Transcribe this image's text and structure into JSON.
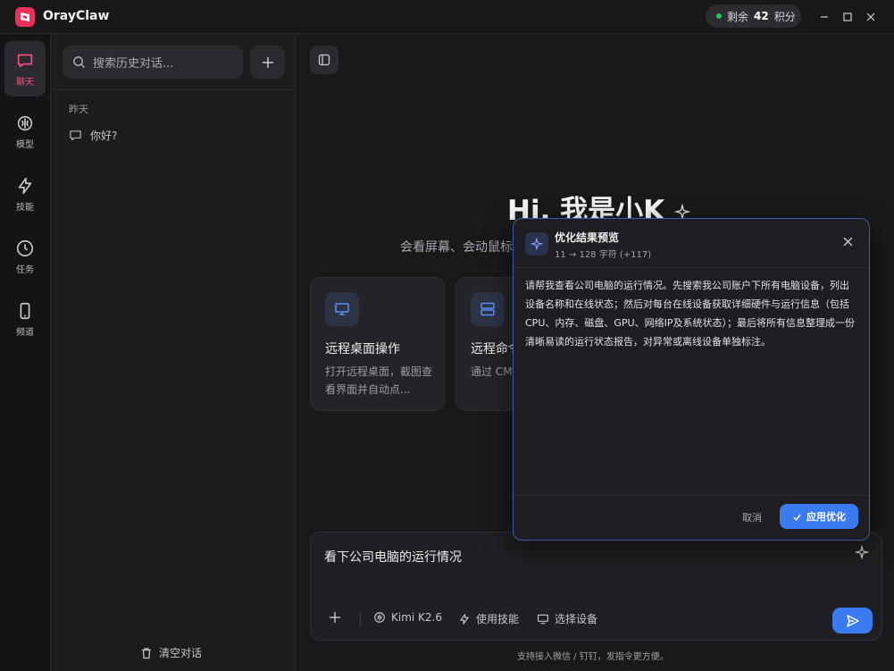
{
  "app": {
    "name": "OrayClaw"
  },
  "credits": {
    "prefix": "剩余",
    "amount": "42",
    "suffix": "积分"
  },
  "rail": {
    "items": [
      {
        "label": "聊天",
        "icon": "chat-icon",
        "active": true
      },
      {
        "label": "模型",
        "icon": "model-icon"
      },
      {
        "label": "技能",
        "icon": "lightning-icon"
      },
      {
        "label": "任务",
        "icon": "clock-icon"
      },
      {
        "label": "频道",
        "icon": "phone-icon"
      }
    ]
  },
  "history": {
    "search_placeholder": "搜索历史对话...",
    "group_label": "昨天",
    "items": [
      {
        "title": "你好?"
      }
    ],
    "clear_label": "清空对话"
  },
  "main": {
    "hero_title": "Hi, 我是小K",
    "hero_subtitle": "会看屏幕、会动鼠标",
    "cards": [
      {
        "title": "远程桌面操作",
        "desc": "打开远程桌面，截图查看界面并自动点...",
        "icon": "monitor-icon"
      },
      {
        "title": "远程命令",
        "desc": "通过 CMD 程设备上",
        "icon": "server-icon"
      }
    ],
    "composer": {
      "input_value": "看下公司电脑的运行情况",
      "model_label": "Kimi K2.6",
      "skills_label": "使用技能",
      "device_label": "选择设备"
    },
    "footer_note": "支持接入微信 / 钉钉，发指令更方便。"
  },
  "modal": {
    "title": "优化结果预览",
    "meta": "11 → 128 字符 (+117)",
    "body": "请帮我查看公司电脑的运行情况。先搜索我公司账户下所有电脑设备，列出设备名称和在线状态；然后对每台在线设备获取详细硬件与运行信息（包括CPU、内存、磁盘、GPU、网络IP及系统状态）；最后将所有信息整理成一份清晰易读的运行状态报告，对异常或离线设备单独标注。",
    "cancel_label": "取消",
    "apply_label": "应用优化"
  },
  "colors": {
    "accent": "#3a7bf2",
    "brand": "#e8315a",
    "active_rail": "#ff4f7a"
  }
}
